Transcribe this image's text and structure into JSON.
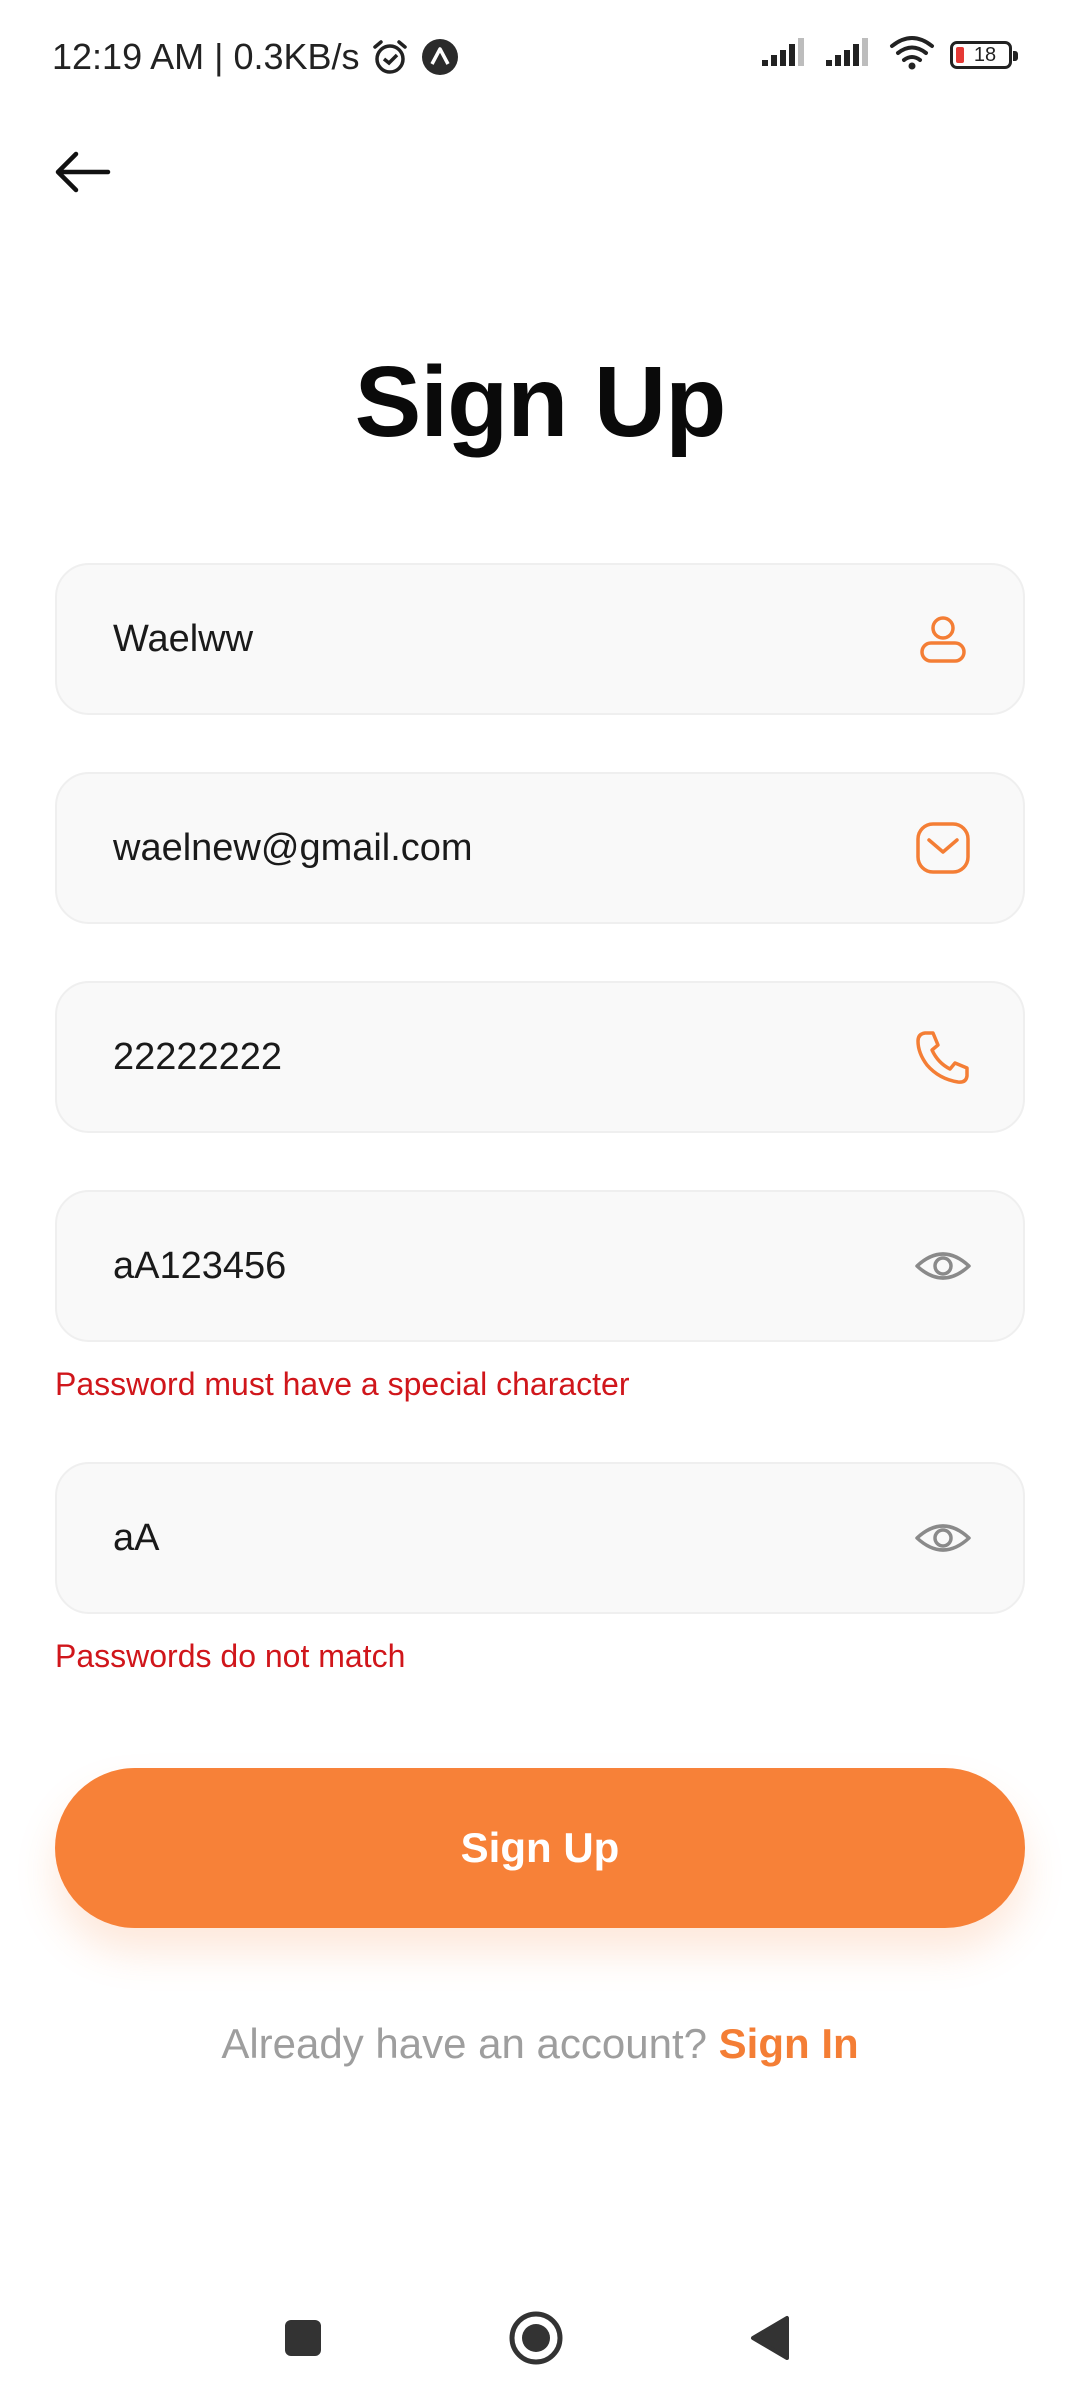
{
  "status_bar": {
    "time_speed": "12:19 AM | 0.3KB/s",
    "battery_level": "18",
    "icons": [
      "alarm-icon",
      "app-notification-icon",
      "signal-icon",
      "signal-icon",
      "wifi-icon",
      "battery-icon"
    ]
  },
  "header": {
    "back_icon": "arrow-left-icon"
  },
  "title": "Sign Up",
  "form": {
    "name": {
      "value": "Waelww",
      "icon": "user-icon"
    },
    "email": {
      "value": "waelnew@gmail.com",
      "icon": "mail-icon"
    },
    "phone": {
      "value": "22222222",
      "icon": "phone-icon"
    },
    "password": {
      "value": "aA123456",
      "icon": "eye-icon",
      "error": "Password must have a special character"
    },
    "confirm_password": {
      "value": "aA",
      "icon": "eye-icon",
      "error": "Passwords do not match"
    }
  },
  "submit_label": "Sign Up",
  "footer": {
    "prompt": "Already have an account?",
    "link": "Sign In"
  },
  "colors": {
    "accent": "#f78138",
    "error": "#d0161b",
    "field_bg": "#f9f9f9",
    "muted_text": "#9e9e9e"
  },
  "nav": {
    "icons": [
      "recents-square-icon",
      "home-circle-icon",
      "back-triangle-icon"
    ]
  }
}
